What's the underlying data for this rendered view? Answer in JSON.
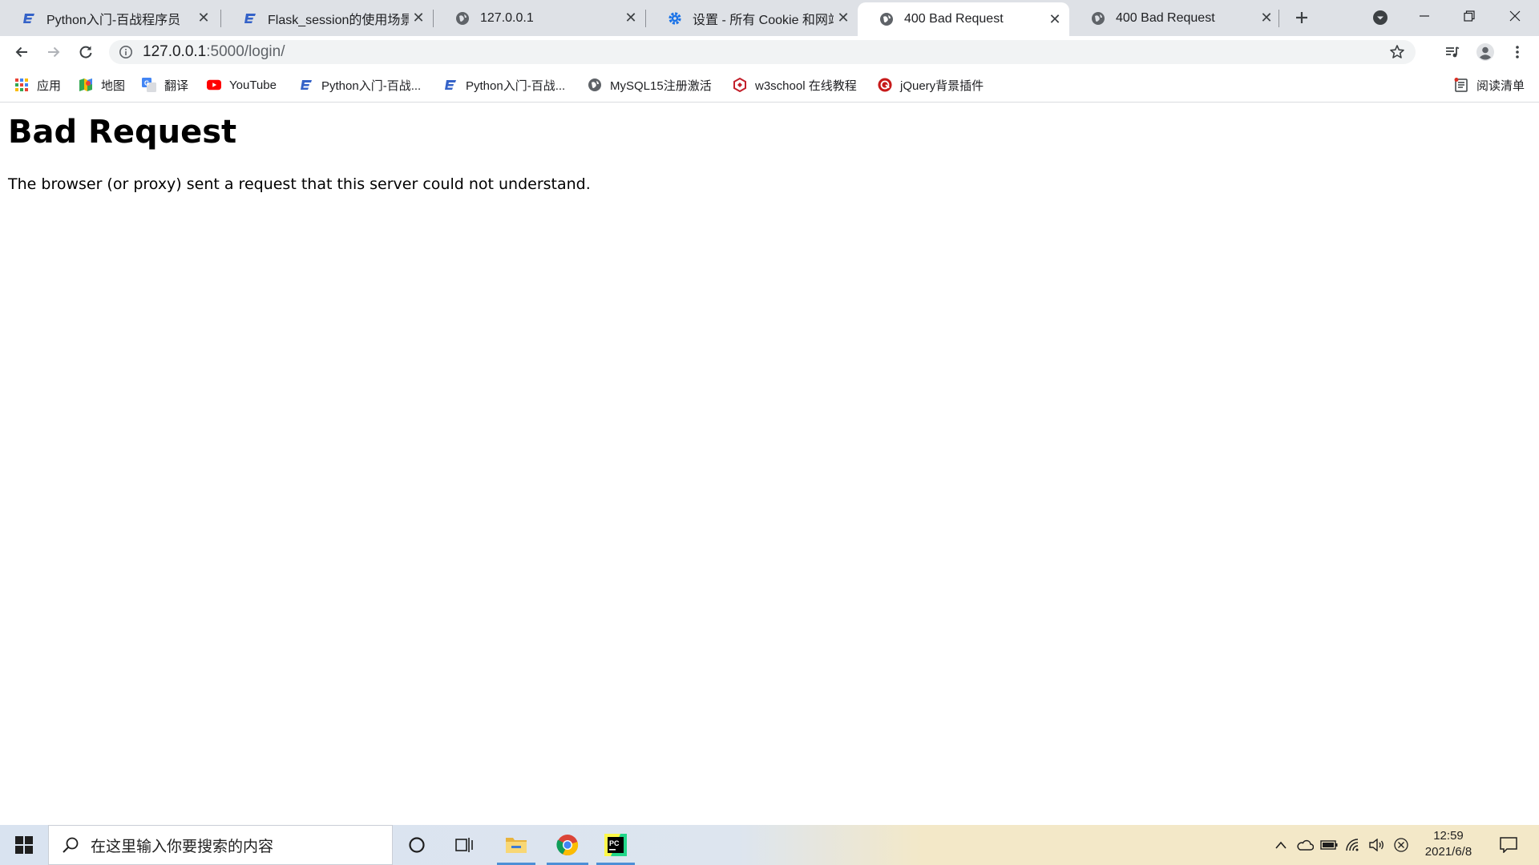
{
  "tabs": [
    {
      "title": "Python入门-百战程序员",
      "icon": "csdn-icon"
    },
    {
      "title": "Flask_session的使用场景-",
      "icon": "csdn-icon"
    },
    {
      "title": "127.0.0.1",
      "icon": "globe-icon"
    },
    {
      "title": "设置 - 所有 Cookie 和网站",
      "icon": "gear-icon"
    },
    {
      "title": "400 Bad Request",
      "icon": "globe-icon",
      "active": true
    },
    {
      "title": "400 Bad Request",
      "icon": "globe-icon"
    }
  ],
  "address_bar": {
    "host": "127.0.0.1",
    "path": ":5000/login/"
  },
  "bookmarks": [
    {
      "label": "应用",
      "icon": "apps-grid-icon"
    },
    {
      "label": "地图",
      "icon": "maps-icon"
    },
    {
      "label": "翻译",
      "icon": "translate-icon"
    },
    {
      "label": "YouTube",
      "icon": "youtube-icon"
    },
    {
      "label": "Python入门-百战...",
      "icon": "csdn-icon"
    },
    {
      "label": "Python入门-百战...",
      "icon": "csdn-icon"
    },
    {
      "label": "MySQL15注册激活",
      "icon": "globe-icon"
    },
    {
      "label": "w3school 在线教程",
      "icon": "w3school-icon"
    },
    {
      "label": "jQuery背景插件",
      "icon": "jquery-icon"
    }
  ],
  "reading_list": {
    "label": "阅读清单",
    "icon": "reading-list-icon"
  },
  "page": {
    "heading": "Bad Request",
    "message": "The browser (or proxy) sent a request that this server could not understand."
  },
  "taskbar": {
    "search_placeholder": "在这里输入你要搜索的内容",
    "time": "12:59",
    "date": "2021/6/8"
  },
  "colors": {
    "tab_strip": "#dee1e6",
    "csdn_blue": "#3462c8",
    "youtube_red": "#ff0000",
    "taskbar_accent": "#4c8fd6"
  }
}
